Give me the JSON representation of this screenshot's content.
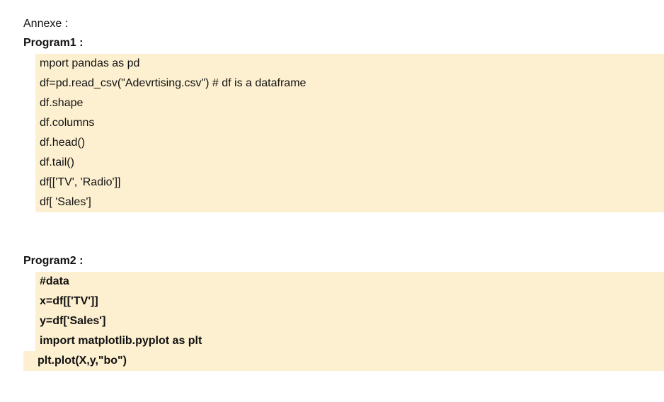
{
  "annex_label": "Annexe :",
  "program1": {
    "title": "Program1 :",
    "lines": [
      "mport pandas as pd",
      "df=pd.read_csv(\"Adevrtising.csv\") # df is a dataframe",
      "df.shape",
      "df.columns",
      "df.head()",
      "df.tail()",
      "df[['TV', 'Radio']]",
      "df[ 'Sales']"
    ]
  },
  "program2": {
    "title": "Program2 :",
    "lines": [
      "#data",
      "x=df[['TV']]",
      "y=df['Sales']",
      "import matplotlib.pyplot as plt",
      "plt.plot(X,y,\"bo\")"
    ]
  },
  "colors": {
    "code_background": "#fdf0d0",
    "text": "#111111"
  }
}
